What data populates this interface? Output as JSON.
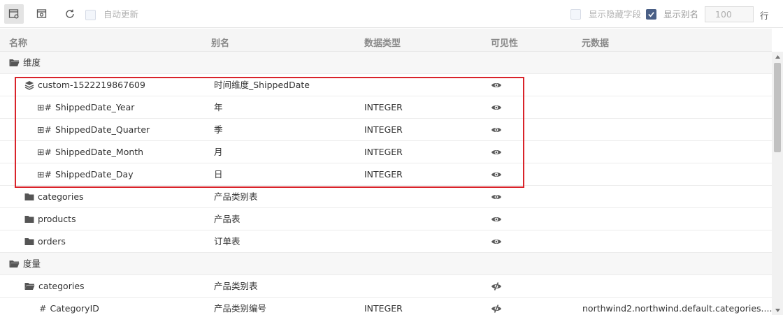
{
  "toolbar": {
    "auto_update_label": "自动更新",
    "show_hidden_label": "显示隐藏字段",
    "show_alias_label": "显示别名",
    "row_count_value": "100",
    "row_unit": "行",
    "show_alias_checked": true
  },
  "columns": {
    "name": "名称",
    "alias": "别名",
    "datatype": "数据类型",
    "visibility": "可见性",
    "metadata": "元数据"
  },
  "rows": [
    {
      "kind": "group",
      "name": "维度",
      "alias": "",
      "datatype": "",
      "visible": "",
      "meta": ""
    },
    {
      "kind": "custom",
      "name": "custom-1522219867609",
      "alias": "时间维度_ShippedDate",
      "datatype": "",
      "visible": "visible",
      "meta": ""
    },
    {
      "kind": "dimfield",
      "name": "ShippedDate_Year",
      "alias": "年",
      "datatype": "INTEGER",
      "visible": "visible",
      "meta": ""
    },
    {
      "kind": "dimfield",
      "name": "ShippedDate_Quarter",
      "alias": "季",
      "datatype": "INTEGER",
      "visible": "visible",
      "meta": ""
    },
    {
      "kind": "dimfield",
      "name": "ShippedDate_Month",
      "alias": "月",
      "datatype": "INTEGER",
      "visible": "visible",
      "meta": ""
    },
    {
      "kind": "dimfield",
      "name": "ShippedDate_Day",
      "alias": "日",
      "datatype": "INTEGER",
      "visible": "visible",
      "meta": ""
    },
    {
      "kind": "folder",
      "name": "categories",
      "alias": "产品类别表",
      "datatype": "",
      "visible": "visible",
      "meta": ""
    },
    {
      "kind": "folder",
      "name": "products",
      "alias": "产品表",
      "datatype": "",
      "visible": "visible",
      "meta": ""
    },
    {
      "kind": "folder",
      "name": "orders",
      "alias": "订单表",
      "datatype": "",
      "visible": "visible",
      "meta": ""
    },
    {
      "kind": "group",
      "name": "度量",
      "alias": "",
      "datatype": "",
      "visible": "",
      "meta": ""
    },
    {
      "kind": "folder",
      "name": "categories",
      "alias": "产品类别表",
      "datatype": "",
      "visible": "hidden",
      "meta": ""
    },
    {
      "kind": "measure",
      "name": "CategoryID",
      "alias": "产品类别编号",
      "datatype": "INTEGER",
      "visible": "hidden",
      "meta": "northwind2.northwind.default.categories...."
    }
  ],
  "colors": {
    "highlight": "#d9232a",
    "checkbox_checked": "#4a5f86"
  }
}
